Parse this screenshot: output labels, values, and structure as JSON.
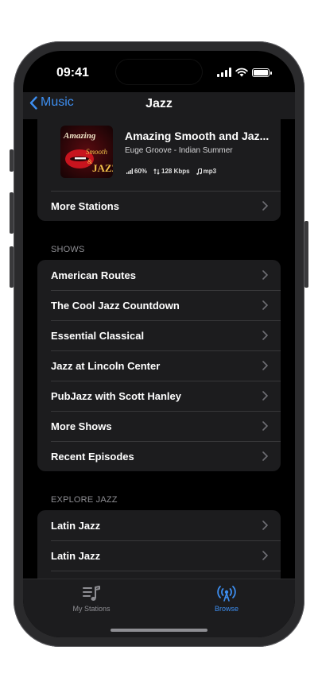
{
  "status_bar": {
    "time": "09:41"
  },
  "nav": {
    "back_label": "Music",
    "title": "Jazz"
  },
  "station": {
    "name": "Amazing Smooth and Jaz...",
    "now_playing": "Euge Groove - Indian Summer",
    "signal": "60%",
    "bitrate": "128 Kbps",
    "format": "mp3",
    "art_lines": [
      "Amazing",
      "Smooth",
      "&",
      "JAZZ"
    ],
    "more_label": "More Stations"
  },
  "shows": {
    "header": "SHOWS",
    "items": [
      {
        "label": "American Routes"
      },
      {
        "label": "The Cool Jazz Countdown"
      },
      {
        "label": "Essential Classical"
      },
      {
        "label": "Jazz at Lincoln Center"
      },
      {
        "label": "PubJazz with Scott Hanley"
      },
      {
        "label": "More Shows"
      },
      {
        "label": "Recent Episodes"
      }
    ]
  },
  "explore": {
    "header": "EXPLORE JAZZ",
    "items": [
      {
        "label": "Latin Jazz"
      },
      {
        "label": "Latin Jazz"
      }
    ]
  },
  "tabbar": {
    "items": [
      {
        "label": "My Stations",
        "icon": "music-list-icon",
        "active": false
      },
      {
        "label": "Browse",
        "icon": "broadcast-icon",
        "active": true
      }
    ]
  },
  "colors": {
    "accent": "#3d8ef0",
    "background": "#000000",
    "card": "#1c1c1e",
    "secondary_text": "#8e8e93"
  }
}
